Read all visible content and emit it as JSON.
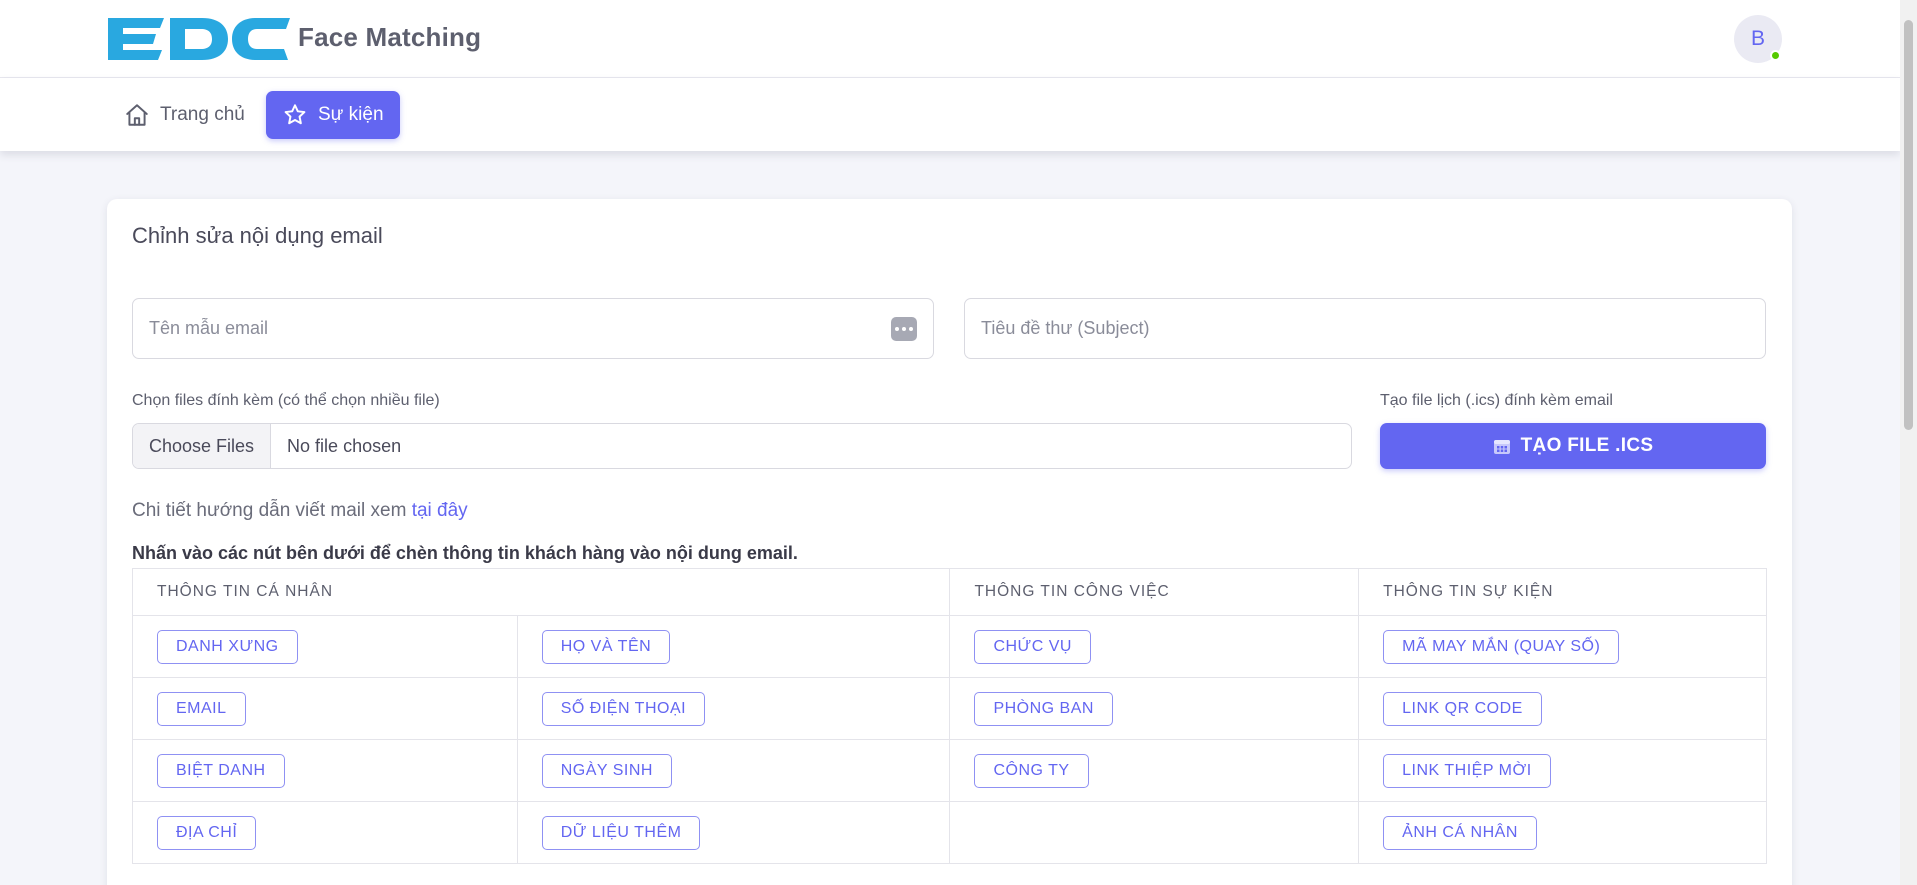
{
  "header": {
    "logo_text": "EDC",
    "app_title": "Face Matching",
    "avatar_initial": "B"
  },
  "nav": {
    "home_label": "Trang chủ",
    "events_label": "Sự kiện"
  },
  "card": {
    "title": "Chỉnh sửa nội dụng email",
    "template_name_placeholder": "Tên mẫu email",
    "subject_placeholder": "Tiêu đề thư (Subject)",
    "files_label": "Chọn files đính kèm (có thể chọn nhiều file)",
    "choose_files_label": "Choose Files",
    "no_file_label": "No file chosen",
    "ics_label": "Tạo file lịch (.ics) đính kèm email",
    "ics_button_label": "TẠO FILE .ICS",
    "guide_text": "Chi tiết hướng dẫn viết mail xem ",
    "guide_link": "tại đây",
    "instruction": "Nhấn vào các nút bên dưới để chèn thông tin khách hàng vào nội dung email."
  },
  "table": {
    "headers": [
      "THÔNG TIN CÁ NHÂN",
      "THÔNG TIN CÔNG VIỆC",
      "THÔNG TIN SỰ KIỆN"
    ],
    "rows": [
      [
        "DANH XƯNG",
        "HỌ VÀ TÊN",
        "CHỨC VỤ",
        "MÃ MAY MẮN (QUAY SỐ)"
      ],
      [
        "EMAIL",
        "SỐ ĐIỆN THOẠI",
        "PHÒNG BAN",
        "LINK QR CODE"
      ],
      [
        "BIỆT DANH",
        "NGÀY SINH",
        "CÔNG TY",
        "LINK THIỆP MỜI"
      ],
      [
        "ĐỊA CHỈ",
        "DỮ LIỆU THÊM",
        "",
        "ẢNH CÁ NHÂN"
      ]
    ]
  },
  "colors": {
    "accent": "#6366f1",
    "logo": "#29a8e0",
    "status_online": "#56ca00"
  }
}
